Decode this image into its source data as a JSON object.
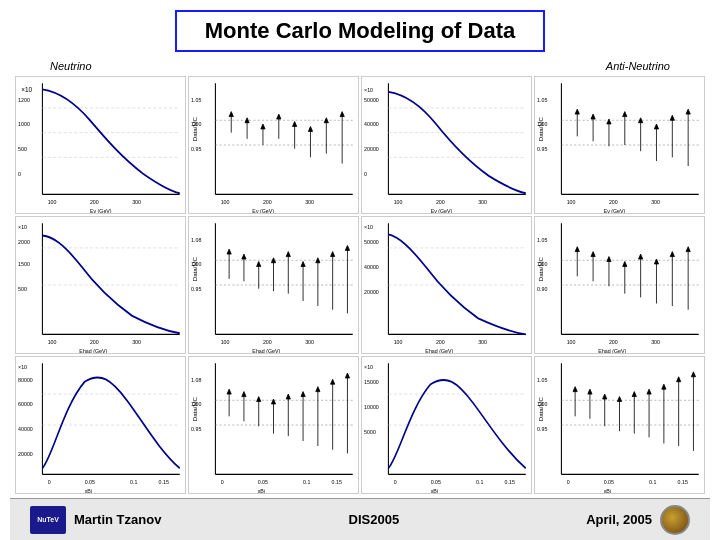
{
  "header": {
    "title": "Monte Carlo Modeling of Data"
  },
  "labels": {
    "neutrino": "Neutrino",
    "anti": "Anti-Neutrino"
  },
  "footer": {
    "author": "Martin Tzanov",
    "conference": "DIS2005",
    "date": "April, 2005",
    "logo_text": "NuTeV"
  },
  "plots": [
    {
      "id": "p1",
      "row": 0,
      "col": 0,
      "type": "spectrum"
    },
    {
      "id": "p2",
      "row": 0,
      "col": 1,
      "type": "ratio"
    },
    {
      "id": "p3",
      "row": 0,
      "col": 2,
      "type": "spectrum"
    },
    {
      "id": "p4",
      "row": 0,
      "col": 3,
      "type": "ratio"
    },
    {
      "id": "p5",
      "row": 1,
      "col": 0,
      "type": "spectrum"
    },
    {
      "id": "p6",
      "row": 1,
      "col": 1,
      "type": "ratio"
    },
    {
      "id": "p7",
      "row": 1,
      "col": 2,
      "type": "spectrum"
    },
    {
      "id": "p8",
      "row": 1,
      "col": 3,
      "type": "ratio"
    },
    {
      "id": "p9",
      "row": 2,
      "col": 0,
      "type": "spectrum_xbj"
    },
    {
      "id": "p10",
      "row": 2,
      "col": 1,
      "type": "ratio_xbj"
    },
    {
      "id": "p11",
      "row": 2,
      "col": 2,
      "type": "spectrum_xbj"
    },
    {
      "id": "p12",
      "row": 2,
      "col": 3,
      "type": "ratio_xbj"
    }
  ]
}
